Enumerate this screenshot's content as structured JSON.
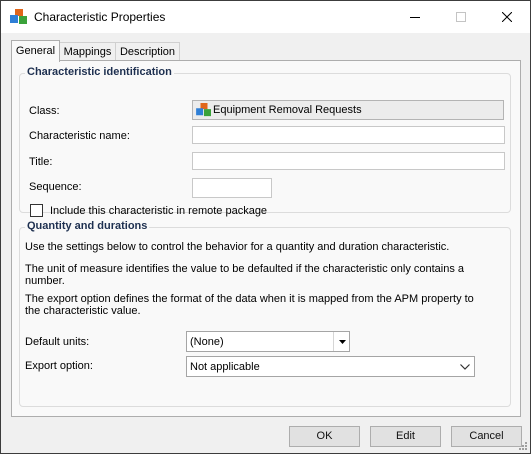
{
  "window": {
    "title": "Characteristic Properties"
  },
  "tabs": [
    {
      "label": "General"
    },
    {
      "label": "Mappings"
    },
    {
      "label": "Description"
    }
  ],
  "identification": {
    "heading": "Characteristic identification",
    "class_label": "Class:",
    "class_value": "Equipment Removal Requests",
    "name_label": "Characteristic name:",
    "name_value": "",
    "title_label": "Title:",
    "title_value": "",
    "sequence_label": "Sequence:",
    "sequence_value": "",
    "remote_checkbox_label": "Include this characteristic in remote package",
    "remote_checked": false
  },
  "quantity": {
    "heading": "Quantity and durations",
    "para1": "Use the settings below to control  the behavior for a quantity and duration characteristic.",
    "para2": "The unit of measure identifies the value to be defaulted if the characteristic only contains a number.",
    "para3": "The export option defines the format of the data when it is mapped from the APM property to the characteristic value.",
    "units_label": "Default units:",
    "units_value": "(None)",
    "export_label": "Export option:",
    "export_value": "Not applicable"
  },
  "buttons": {
    "ok": "OK",
    "edit": "Edit",
    "cancel": "Cancel"
  }
}
